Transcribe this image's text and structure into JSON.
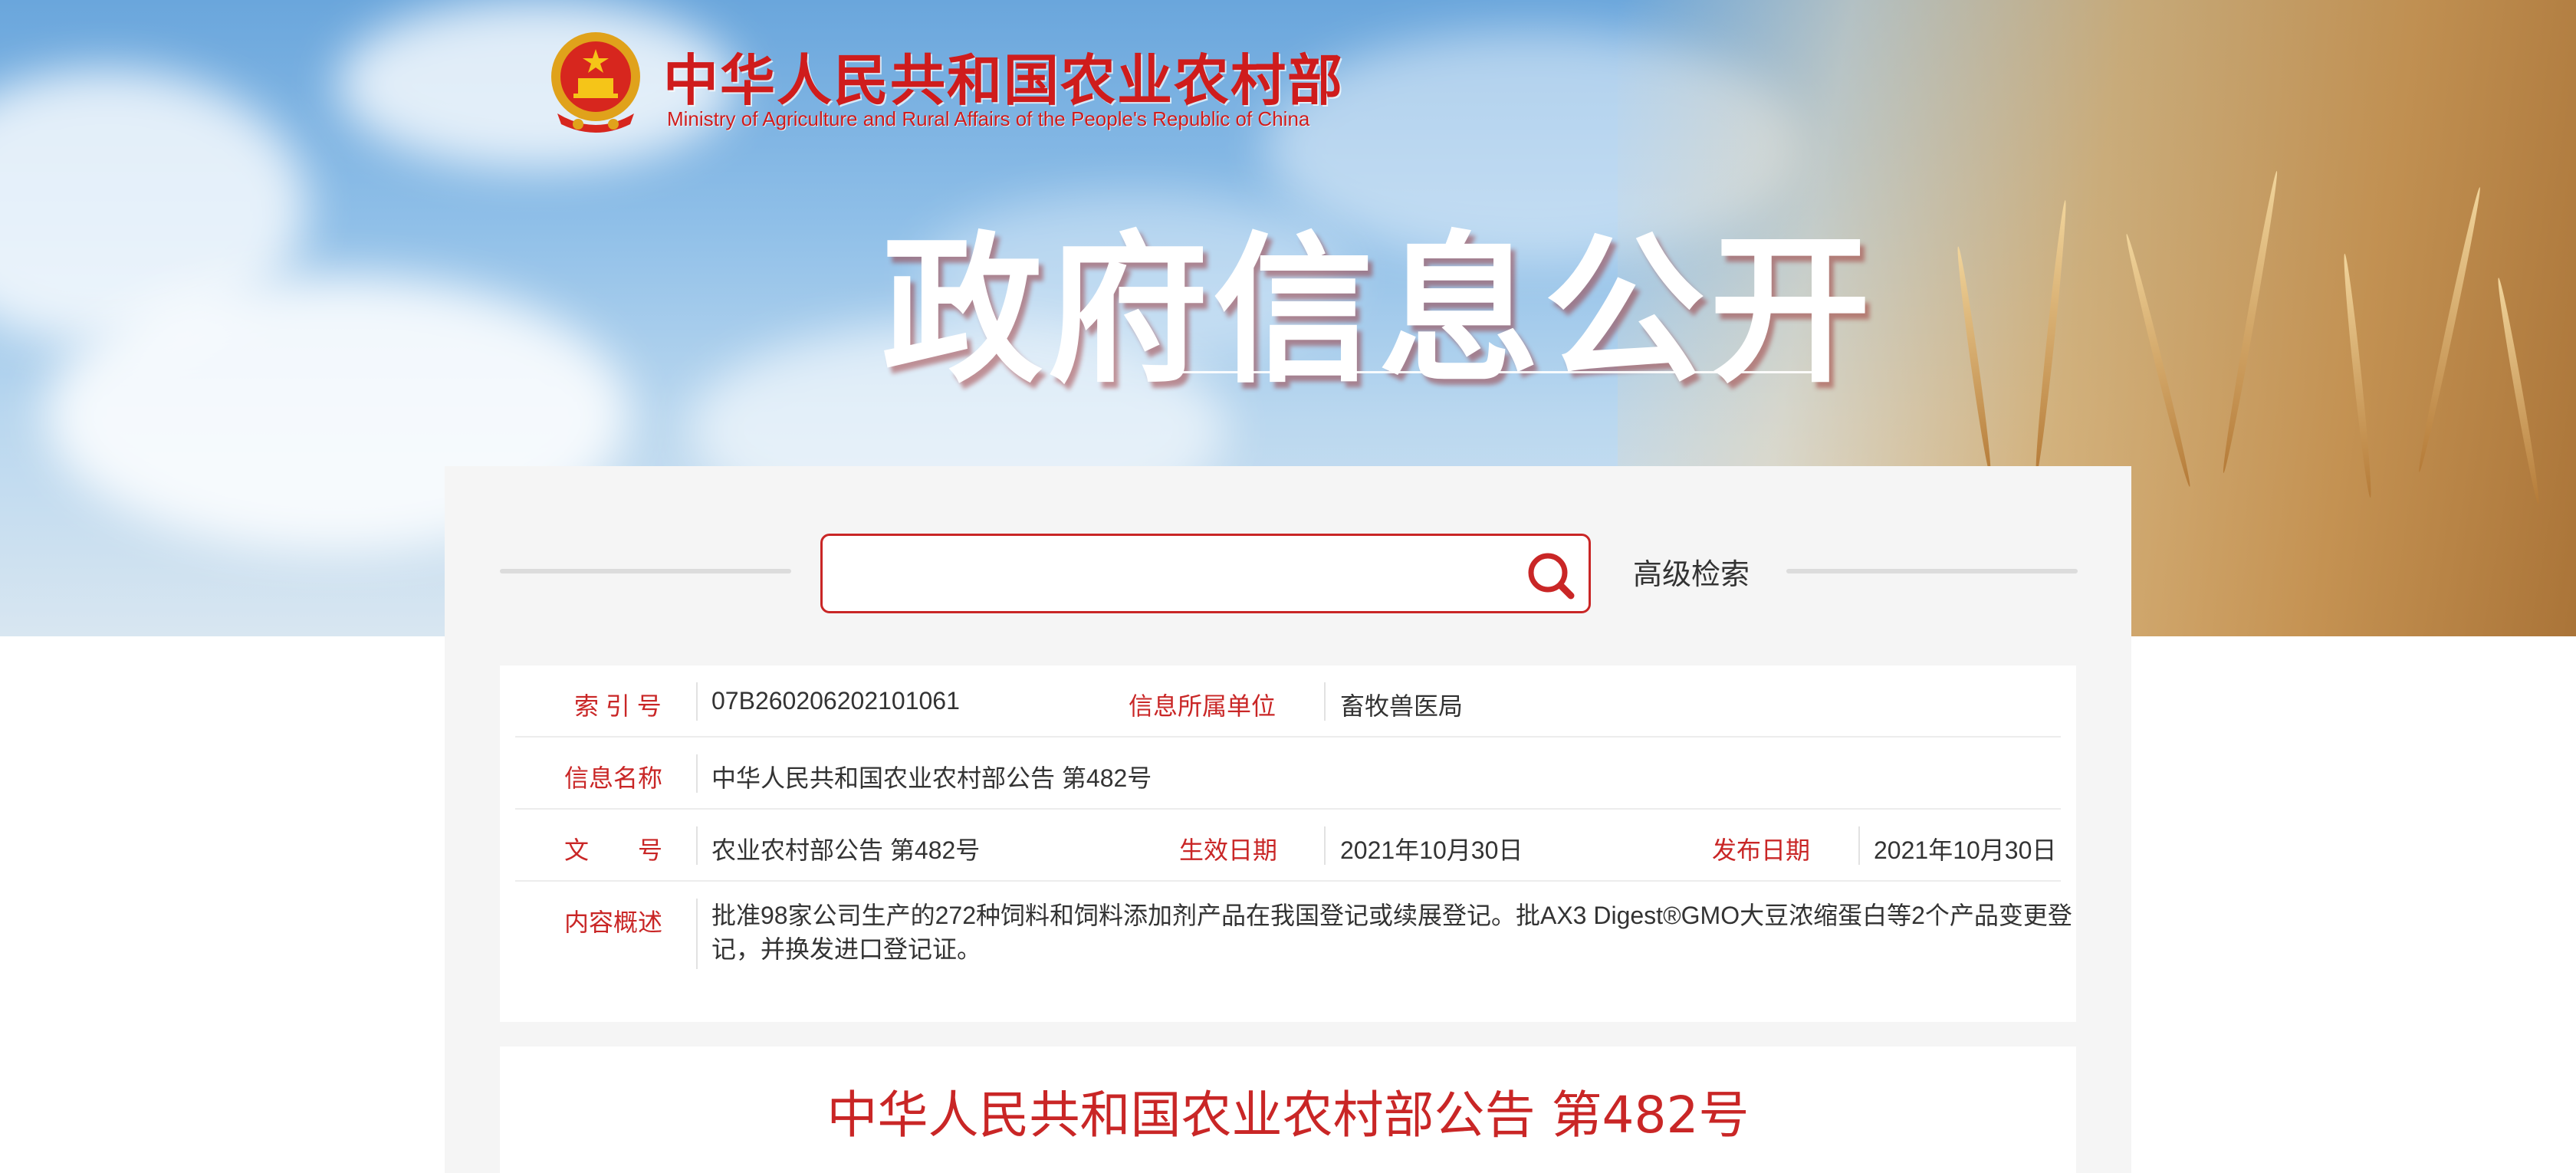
{
  "header": {
    "ministry_cn": "中华人民共和国农业农村部",
    "ministry_en": "Ministry of Agriculture and Rural Affairs of the People's Republic of China",
    "banner_title": "政府信息公开",
    "emblem_icon": "national-emblem-icon"
  },
  "search": {
    "placeholder": "",
    "value": "",
    "search_icon": "search-icon",
    "advanced_label": "高级检索"
  },
  "info": {
    "index_label": "索 引 号",
    "index_value": "07B260206202101061",
    "unit_label": "信息所属单位",
    "unit_value": "畜牧兽医局",
    "name_label": "信息名称",
    "name_value": "中华人民共和国农业农村部公告 第482号",
    "docno_label": "文　　号",
    "docno_value": "农业农村部公告 第482号",
    "effective_label": "生效日期",
    "effective_value": "2021年10月30日",
    "publish_label": "发布日期",
    "publish_value": "2021年10月30日",
    "summary_label": "内容概述",
    "summary_value": "批准98家公司生产的272种饲料和饲料添加剂产品在我国登记或续展登记。批AX3 Digest®GMO大豆浓缩蛋白等2个产品变更登记，并换发进口登记证。"
  },
  "document": {
    "title": "中华人民共和国农业农村部公告 第482号"
  },
  "colors": {
    "accent_red": "#c92626",
    "panel_bg": "#f5f5f5",
    "sky_blue": "#6aa6dc"
  }
}
